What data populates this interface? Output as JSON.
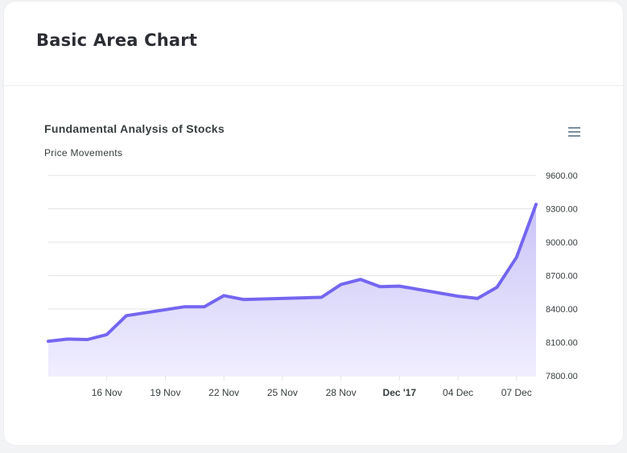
{
  "card": {
    "title": "Basic Area Chart"
  },
  "toolbar": {
    "menu_icon": "hamburger-menu-icon"
  },
  "colors": {
    "line": "#7466f0",
    "area_top": "#c9c3f7",
    "area_bottom": "#f0eefe",
    "grid": "#e3e3e8",
    "text": "#373d3f"
  },
  "chart_data": {
    "type": "area",
    "title": "Fundamental Analysis of Stocks",
    "subtitle": "Price Movements",
    "y_axis_position": "right",
    "ylim": [
      7800,
      9600
    ],
    "y_ticks": [
      9600,
      9300,
      9000,
      8700,
      8400,
      8100,
      7800
    ],
    "y_tick_labels": [
      "9600.00",
      "9300.00",
      "9000.00",
      "8700.00",
      "8400.00",
      "8100.00",
      "7800.00"
    ],
    "x_tick_labels": [
      "16 Nov",
      "19 Nov",
      "22 Nov",
      "25 Nov",
      "28 Nov",
      "Dec '17",
      "04 Dec",
      "07 Dec"
    ],
    "x_tick_days": [
      16,
      19,
      22,
      25,
      28,
      31,
      34,
      37
    ],
    "bold_tick": "Dec '17",
    "grid": true,
    "series": [
      {
        "x": [
          13,
          14,
          15,
          16,
          17,
          20,
          21,
          22,
          23,
          27,
          28,
          29,
          30,
          31,
          34,
          35,
          36,
          37,
          38
        ],
        "values": [
          8110,
          8130,
          8125,
          8170,
          8340,
          8420,
          8420,
          8520,
          8485,
          8505,
          8620,
          8665,
          8600,
          8605,
          8515,
          8495,
          8595,
          8865,
          9340
        ]
      }
    ]
  }
}
